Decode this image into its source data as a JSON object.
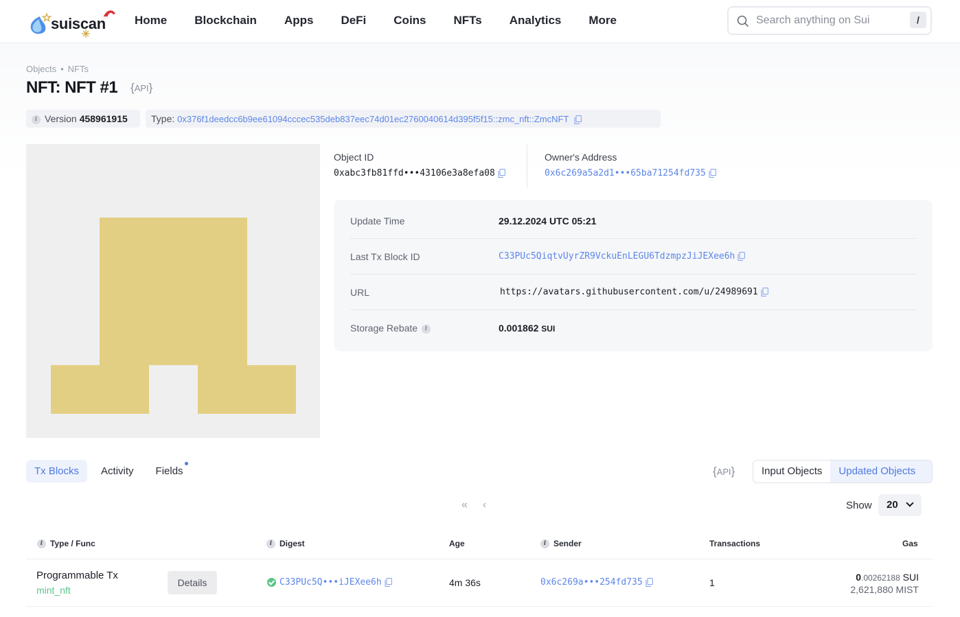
{
  "brand": {
    "name": "suiscan"
  },
  "nav": [
    "Home",
    "Blockchain",
    "Apps",
    "DeFi",
    "Coins",
    "NFTs",
    "Analytics",
    "More"
  ],
  "search": {
    "placeholder": "Search anything on Sui",
    "shortcut": "/"
  },
  "breadcrumb": [
    "Objects",
    "NFTs"
  ],
  "title": "NFT: NFT #1",
  "api_label": "API",
  "version": {
    "label": "Version",
    "value": "458961915"
  },
  "type": {
    "label": "Type:",
    "value": "0x376f1deedcc6b9ee61094cccec535deb837eec74d01ec2760040614d395f5f15::zmc_nft::ZmcNFT"
  },
  "object": {
    "id_label": "Object ID",
    "id_value": "0xabc3fb81ffd•••43106e3a8efa08",
    "owner_label": "Owner's Address",
    "owner_value": "0x6c269a5a2d1•••65ba71254fd735"
  },
  "details": [
    {
      "label": "Update Time",
      "value": "29.12.2024 UTC 05:21"
    },
    {
      "label": "Last Tx Block ID",
      "value": "C33PUc5QiqtvUyrZR9VckuEnLEGU6TdzmpzJiJEXee6h"
    },
    {
      "label": "URL",
      "value": "https://avatars.githubusercontent.com/u/24989691"
    },
    {
      "label": "Storage Rebate",
      "value": "0.001862",
      "unit": "SUI"
    }
  ],
  "tabs": [
    "Tx Blocks",
    "Activity",
    "Fields"
  ],
  "segment": [
    "Input Objects",
    "Updated Objects"
  ],
  "pagination": {
    "first": "«",
    "prev": "‹",
    "show_label": "Show",
    "page_size": "20"
  },
  "table": {
    "headers": [
      "Type / Func",
      "Digest",
      "Age",
      "Sender",
      "Transactions",
      "Gas"
    ],
    "rows": [
      {
        "type": "Programmable Tx",
        "func": "mint_nft",
        "action": "Details",
        "digest": "C33PUc5Q•••iJEXee6h",
        "age": "4m 36s",
        "sender": "0x6c269a•••254fd735",
        "transactions": "1",
        "gas_int": "0",
        "gas_dec": ".00262188",
        "gas_unit": "SUI",
        "gas_mist": "2,621,880 MIST"
      }
    ]
  },
  "colors": {
    "accent": "#4e7ae0",
    "link": "#5c86e8",
    "nft_bg": "#efefef",
    "nft_fill": "#e3cf83",
    "success": "#5bc58a"
  }
}
